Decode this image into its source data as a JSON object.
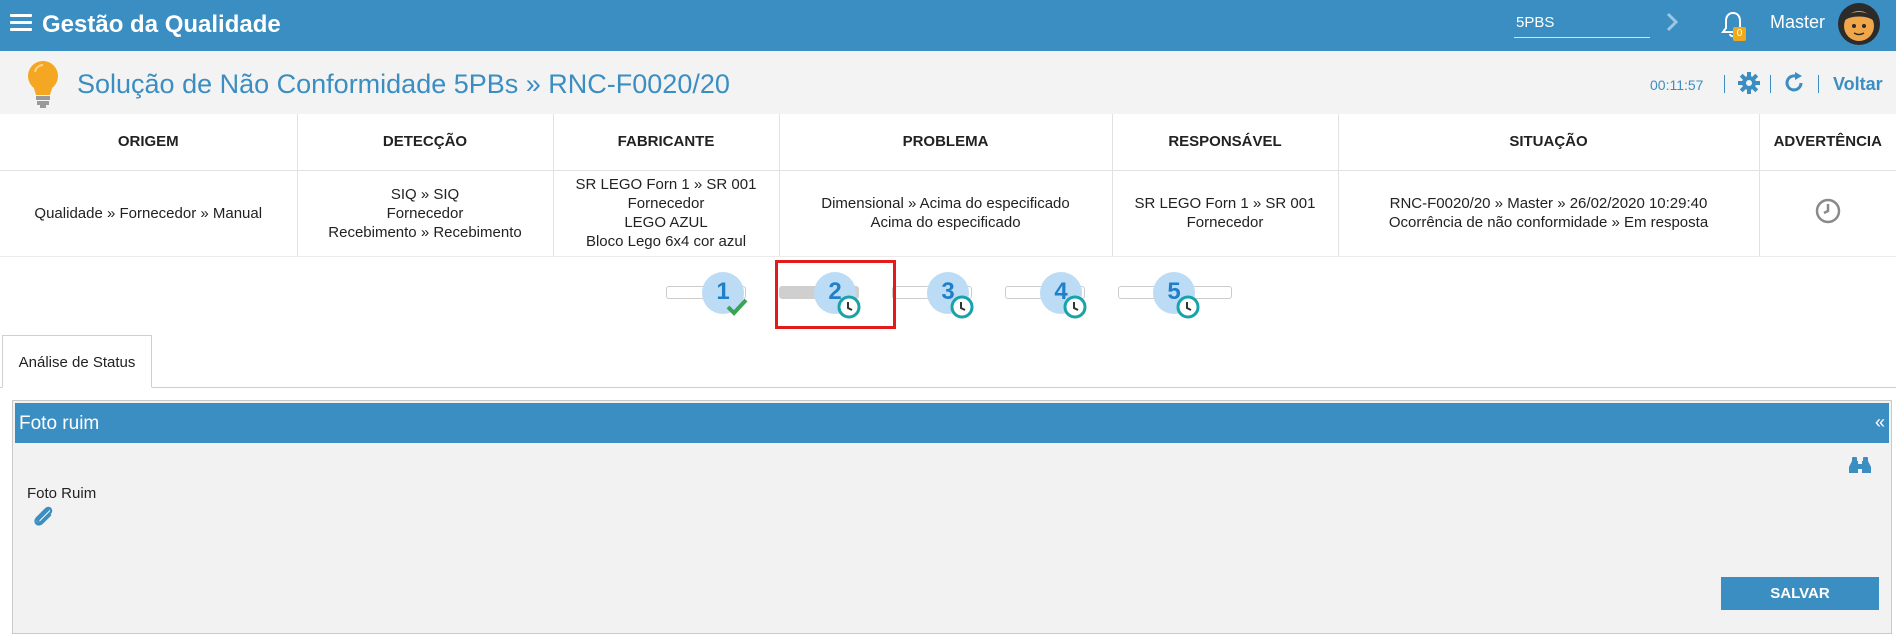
{
  "topbar": {
    "app_title": "Gestão da Qualidade",
    "search_value": "5PBS",
    "notification_count": "0",
    "user_name": "Master"
  },
  "header": {
    "page_title": "Solução de Não Conformidade 5PBs » RNC-F0020/20",
    "timer": "00:11:57",
    "back_label": "Voltar"
  },
  "table": {
    "columns": [
      "ORIGEM",
      "DETECÇÃO",
      "FABRICANTE",
      "PROBLEMA",
      "RESPONSÁVEL",
      "SITUAÇÃO",
      "ADVERTÊNCIA"
    ],
    "row": {
      "origem": [
        "Qualidade » Fornecedor » Manual"
      ],
      "deteccao": [
        "SIQ » SIQ",
        "Fornecedor",
        "Recebimento » Recebimento"
      ],
      "fabricante": [
        "SR LEGO Forn 1 » SR 001",
        "Fornecedor",
        "LEGO AZUL",
        "Bloco Lego 6x4 cor azul"
      ],
      "problema": [
        "Dimensional » Acima do especificado",
        "Acima do especificado"
      ],
      "responsavel": [
        "SR LEGO Forn 1 » SR 001",
        "Fornecedor"
      ],
      "situacao": [
        "RNC-F0020/20 » Master » 26/02/2020 10:29:40",
        "Ocorrência de não conformidade » Em resposta"
      ]
    }
  },
  "stepper": {
    "steps": [
      {
        "label": "1",
        "status": "check-icon"
      },
      {
        "label": "2",
        "status": "clock-icon"
      },
      {
        "label": "3",
        "status": "clock-icon"
      },
      {
        "label": "4",
        "status": "clock-icon"
      },
      {
        "label": "5",
        "status": "clock-icon"
      }
    ],
    "active_step": 2
  },
  "tabs": [
    {
      "label": "Análise de Status",
      "active": true
    }
  ],
  "panel": {
    "title": "Foto ruim",
    "collapse_glyph": "«",
    "field_label": "Foto Ruim",
    "save_label": "SALVAR"
  },
  "colors": {
    "primary": "#3b8ec2",
    "step_circle": "#bcdcf5",
    "step_number": "#1f7fc9",
    "check": "#3aa356",
    "clock": "#17a3a8",
    "highlight": "#e41b1b",
    "badge": "#f0a91c"
  }
}
